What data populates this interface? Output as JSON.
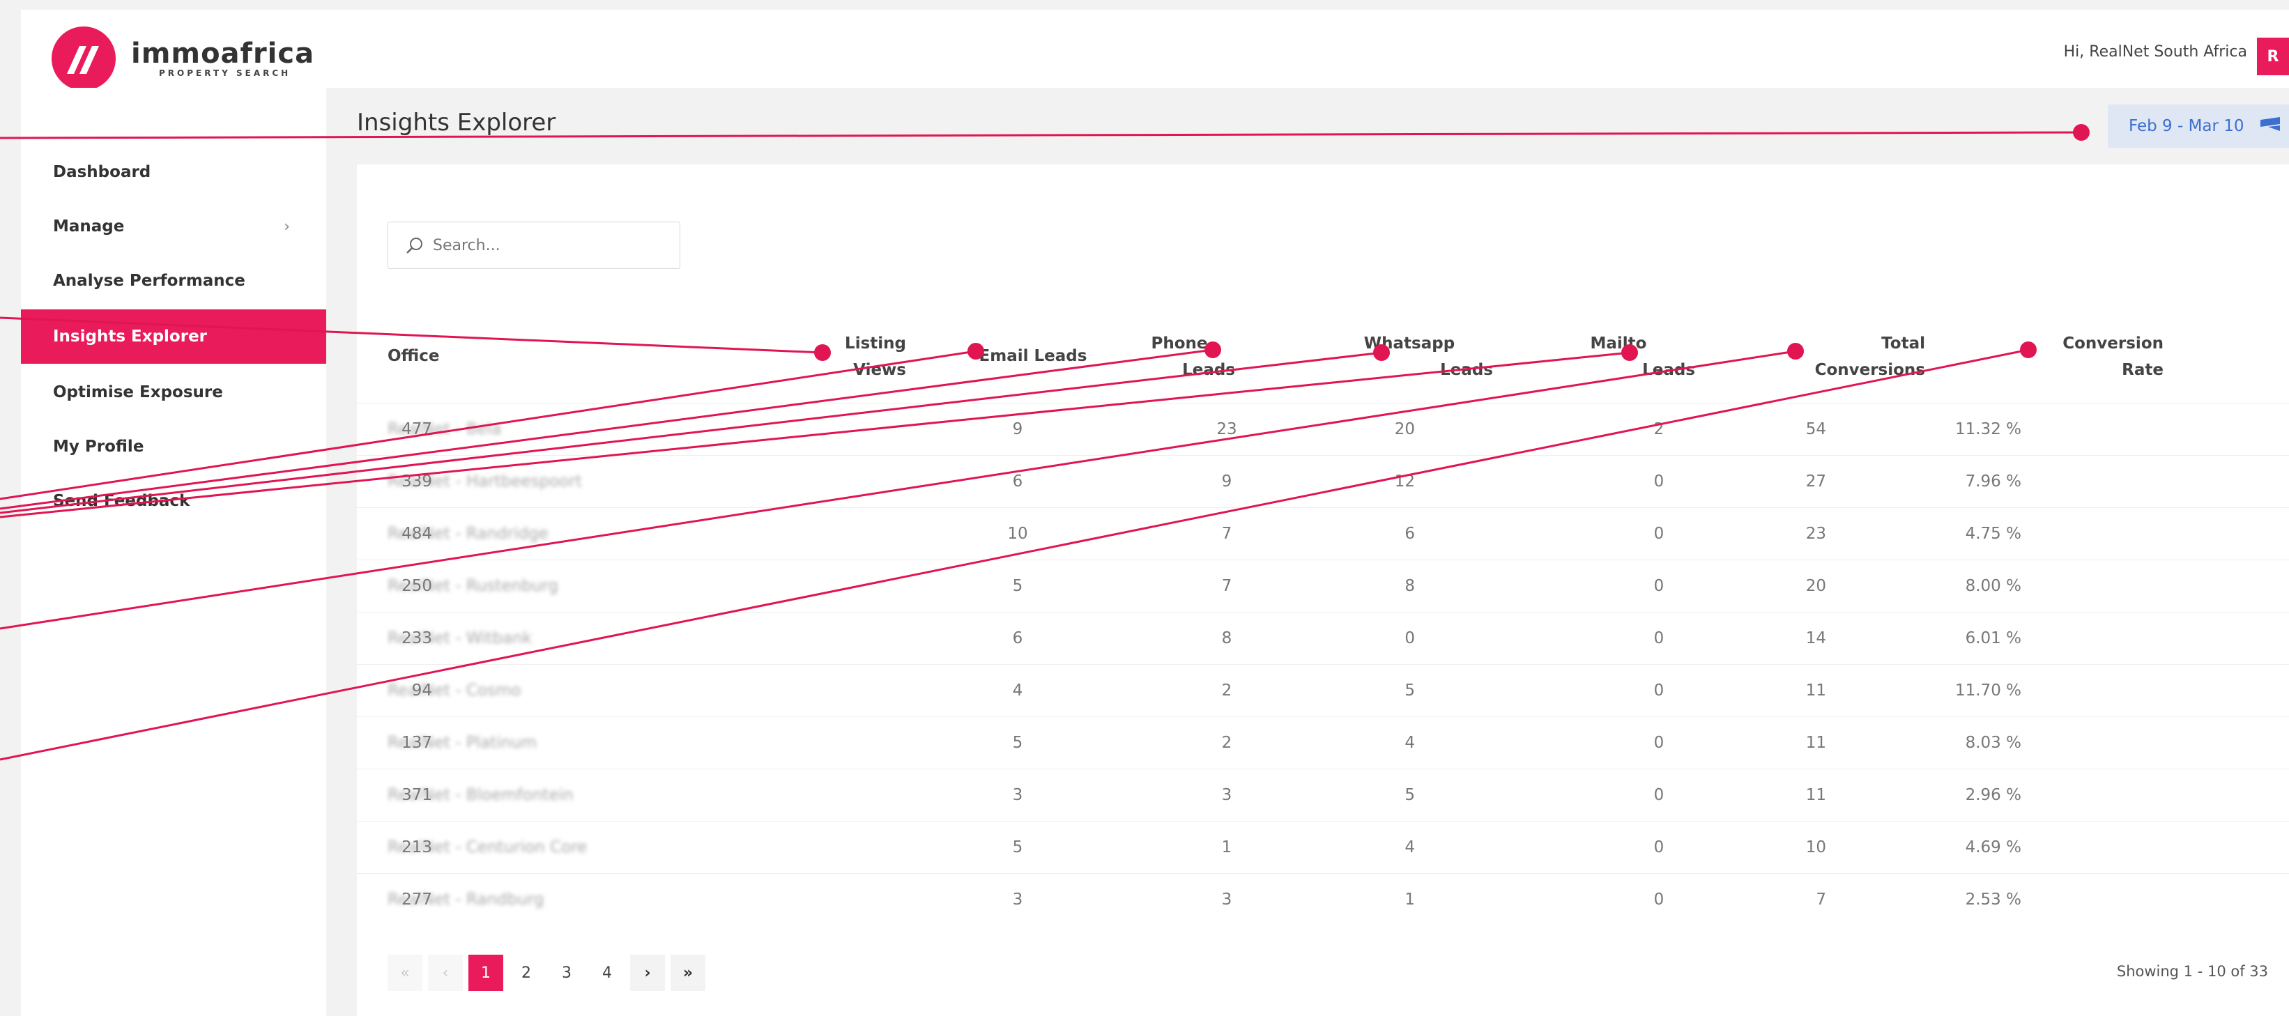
{
  "brand": {
    "name": "immoafrica",
    "tagline": "PROPERTY SEARCH",
    "accent": "#ea1b5a"
  },
  "header": {
    "greeting": "Hi,  RealNet South Africa",
    "avatar_initial": "R"
  },
  "sidebar": {
    "items": [
      {
        "label": "Dashboard",
        "active": false
      },
      {
        "label": "Manage",
        "active": false,
        "chevron": "›"
      },
      {
        "label": "Analyse Performance",
        "active": false
      },
      {
        "label": "Insights Explorer",
        "active": true
      },
      {
        "label": "Optimise Exposure",
        "active": false
      },
      {
        "label": "My Profile",
        "active": false
      },
      {
        "label": "Send Feedback",
        "active": false
      }
    ]
  },
  "main": {
    "title": "Insights Explorer",
    "date_range": "Feb 9 - Mar 10",
    "search_placeholder": "Search...",
    "table": {
      "columns": [
        {
          "line1": "Office",
          "line2": ""
        },
        {
          "line1": "Listing",
          "line2": "Views"
        },
        {
          "line1": "Email Leads",
          "line2": ""
        },
        {
          "line1": "Phone",
          "line2": "Leads"
        },
        {
          "line1": "Whatsapp",
          "line2": "Leads"
        },
        {
          "line1": "Mailto",
          "line2": "Leads"
        },
        {
          "line1": "Total",
          "line2": "Conversions"
        },
        {
          "line1": "Conversion",
          "line2": "Rate"
        }
      ],
      "rows": [
        [
          "RealNet - Bela",
          "477",
          "9",
          "23",
          "20",
          "2",
          "54",
          "11.32 %"
        ],
        [
          "RealNet - Hartbeespoort",
          "339",
          "6",
          "9",
          "12",
          "0",
          "27",
          "7.96 %"
        ],
        [
          "RealNet - Randridge",
          "484",
          "10",
          "7",
          "6",
          "0",
          "23",
          "4.75 %"
        ],
        [
          "RealNet - Rustenburg",
          "250",
          "5",
          "7",
          "8",
          "0",
          "20",
          "8.00 %"
        ],
        [
          "RealNet - Witbank",
          "233",
          "6",
          "8",
          "0",
          "0",
          "14",
          "6.01 %"
        ],
        [
          "RealNet - Cosmo",
          "94",
          "4",
          "2",
          "5",
          "0",
          "11",
          "11.70 %"
        ],
        [
          "RealNet - Platinum",
          "137",
          "5",
          "2",
          "4",
          "0",
          "11",
          "8.03 %"
        ],
        [
          "RealNet - Bloemfontein",
          "371",
          "3",
          "3",
          "5",
          "0",
          "11",
          "2.96 %"
        ],
        [
          "RealNet - Centurion Core",
          "213",
          "5",
          "1",
          "4",
          "0",
          "10",
          "4.69 %"
        ],
        [
          "RealNet - Randburg",
          "277",
          "3",
          "3",
          "1",
          "0",
          "7",
          "2.53 %"
        ]
      ]
    },
    "pagination": {
      "first": "«",
      "prev": "‹",
      "pages": [
        "1",
        "2",
        "3",
        "4"
      ],
      "current": "1",
      "next": "›",
      "last": "»",
      "showing": "Showing 1 - 10 of 33"
    }
  },
  "colors": {
    "accent": "#ea1b5a",
    "date_bg": "#dfe7f4",
    "date_text": "#3d6fd0",
    "page_bg": "#f2f2f2"
  }
}
